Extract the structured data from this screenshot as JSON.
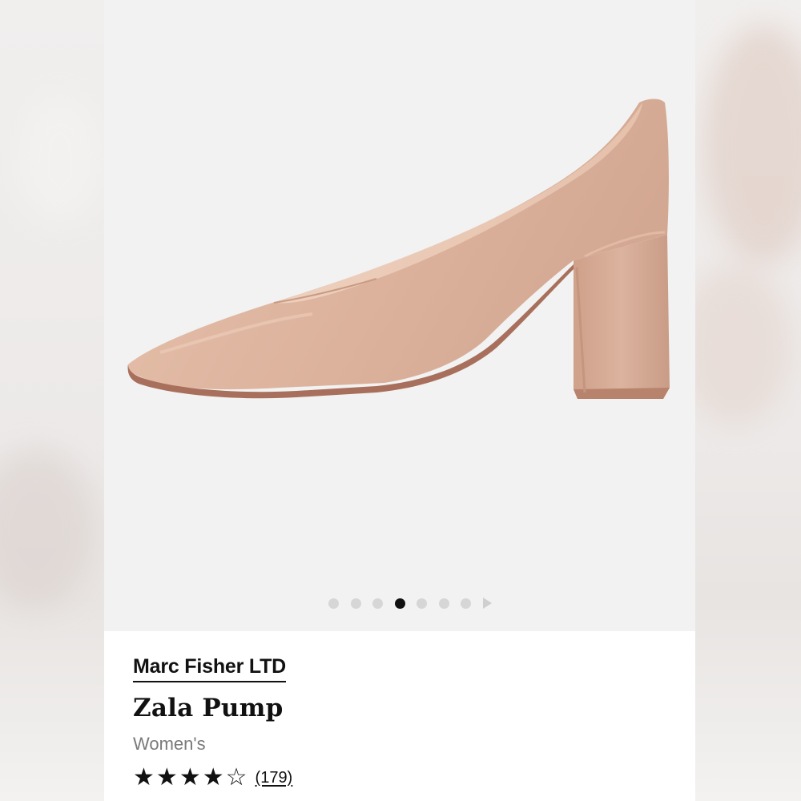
{
  "product": {
    "brand": "Marc Fisher LTD",
    "name": "Zala Pump",
    "gender": "Women's",
    "rating": 4,
    "rating_max": 5,
    "review_count": "(179)",
    "image_icon": "beige-pointed-toe-block-heel-pump"
  },
  "gallery": {
    "total_images": 7,
    "active_index": 3,
    "next_icon": "play-arrow-icon"
  },
  "stars": {
    "filled": "★",
    "empty": "☆"
  },
  "colors": {
    "shoe": "#dfb6a0",
    "background": "#f2f2f2",
    "text": "#111111",
    "muted_text": "#7a7a7a",
    "active_dot": "#111111",
    "inactive_dot": "#d6d6d6"
  }
}
